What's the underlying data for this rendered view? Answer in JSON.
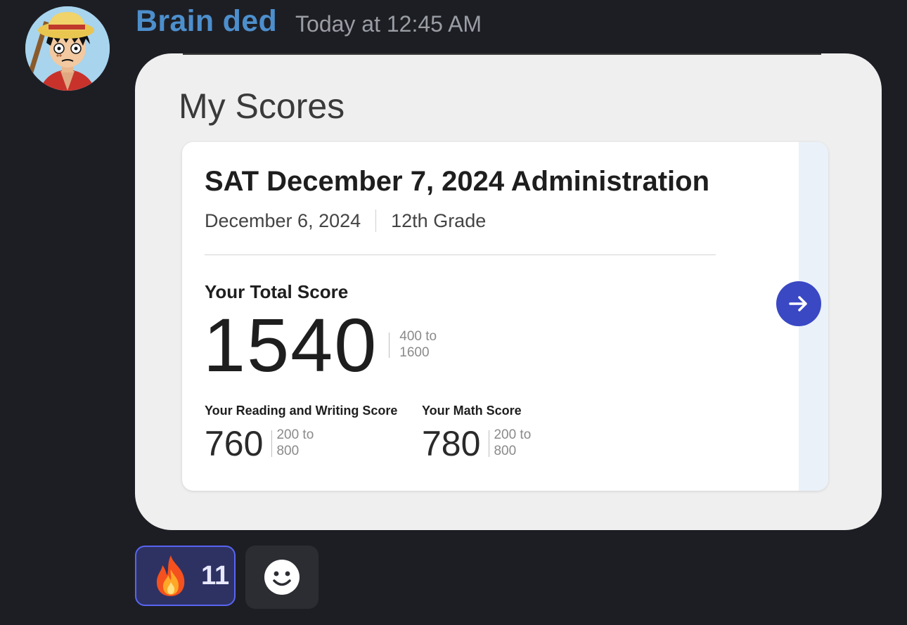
{
  "message": {
    "author": "Brain ded",
    "timestamp": "Today at 12:45 AM",
    "author_color": "#4d8fcd"
  },
  "embed": {
    "section_title": "My Scores",
    "card": {
      "exam_title": "SAT December 7, 2024 Administration",
      "date": "December 6, 2024",
      "grade": "12th Grade",
      "total": {
        "label": "Your Total Score",
        "score": "1540",
        "range_line1": "400 to",
        "range_line2": "1600"
      },
      "reading_writing": {
        "label": "Your Reading and Writing Score",
        "score": "760",
        "range_line1": "200 to",
        "range_line2": "800"
      },
      "math": {
        "label": "Your Math Score",
        "score": "780",
        "range_line1": "200 to",
        "range_line2": "800"
      },
      "arrow_icon": "arrow-right-icon",
      "arrow_color": "#3a48c4"
    }
  },
  "reactions": [
    {
      "emoji": "🔥",
      "icon": "fire-emoji",
      "count": "11",
      "active": true
    }
  ],
  "add_reaction_icon": "smiley-face-icon"
}
